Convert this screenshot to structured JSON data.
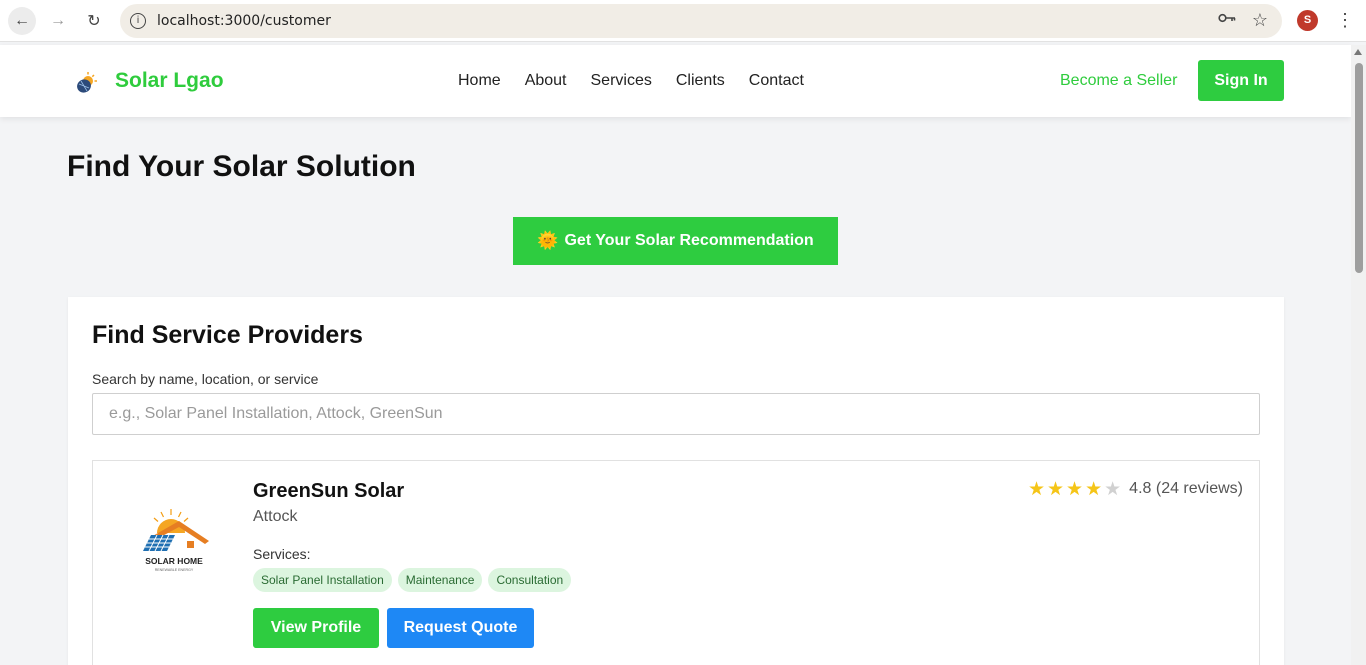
{
  "browser": {
    "url": "localhost:3000/customer",
    "profile_initial": "S",
    "icons": [
      "back-icon",
      "forward-icon",
      "reload-icon",
      "site-info-icon",
      "password-key-icon",
      "bookmark-star-icon",
      "kebab-menu-icon"
    ]
  },
  "header": {
    "brand": "Solar Lgao",
    "nav": [
      "Home",
      "About",
      "Services",
      "Clients",
      "Contact"
    ],
    "become_seller": "Become a Seller",
    "sign_in": "Sign In"
  },
  "main": {
    "title": "Find Your Solar Solution",
    "recommend_icon": "🌞",
    "recommend_label": "Get Your Solar Recommendation"
  },
  "providers": {
    "title": "Find Service Providers",
    "search_label": "Search by name, location, or service",
    "search_placeholder": "e.g., Solar Panel Installation, Attock, GreenSun",
    "search_value": "",
    "list": [
      {
        "name": "GreenSun Solar",
        "location": "Attock",
        "logo_text": "SOLAR HOME",
        "logo_subtext": "RENEWABLE ENERGY",
        "services_label": "Services:",
        "services": [
          "Solar Panel Installation",
          "Maintenance",
          "Consultation"
        ],
        "stars_filled": 4,
        "stars_total": 5,
        "rating_text": "4.8 (24 reviews)",
        "view_label": "View Profile",
        "quote_label": "Request Quote"
      }
    ]
  },
  "colors": {
    "brand_green": "#2ecc40",
    "quote_blue": "#1e88f5",
    "tag_bg": "#dcf5df",
    "star": "#f5c518"
  }
}
